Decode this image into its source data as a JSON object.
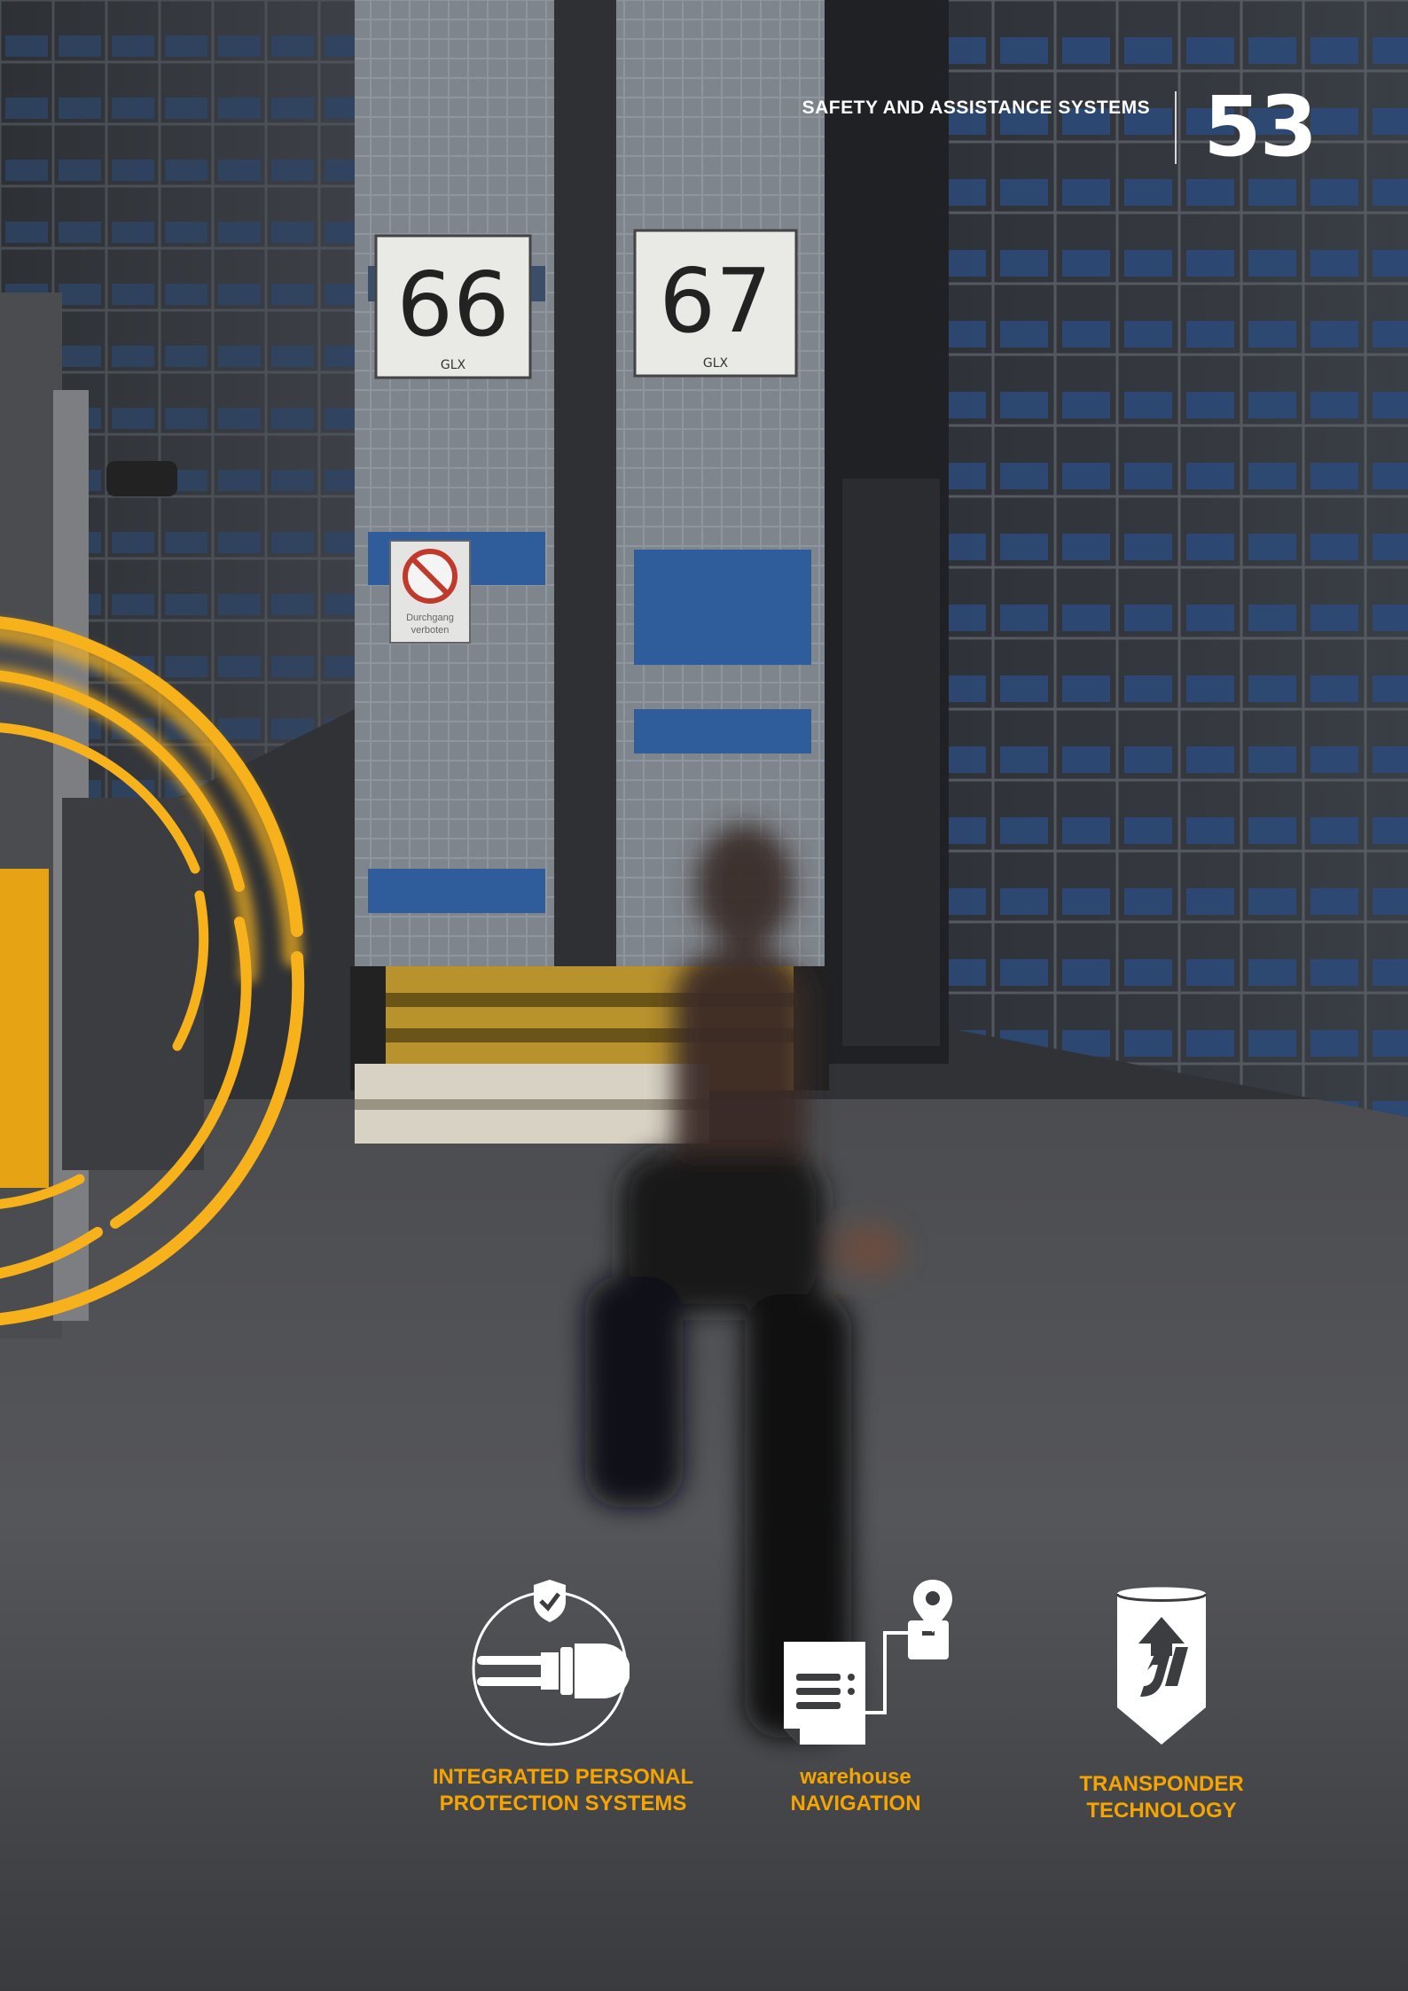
{
  "header": {
    "section_title": "SAFETY AND ASSISTANCE SYSTEMS",
    "page_number": "53"
  },
  "scene": {
    "rack_labels": [
      "66",
      "67"
    ],
    "rack_brand": "GLX",
    "sign_text": "Durchgang verboten"
  },
  "features": [
    {
      "icon": "shield-forklift-icon",
      "line1": "INTEGRATED PERSONAL",
      "line2": "PROTECTION SYSTEMS"
    },
    {
      "icon": "document-location-icon",
      "line1": "warehouse",
      "line2": "NAVIGATION"
    },
    {
      "icon": "transponder-tag-icon",
      "line1": "TRANSPONDER",
      "line2": "TECHNOLOGY"
    }
  ],
  "colors": {
    "accent": "#f5a400",
    "text": "#ffffff"
  }
}
